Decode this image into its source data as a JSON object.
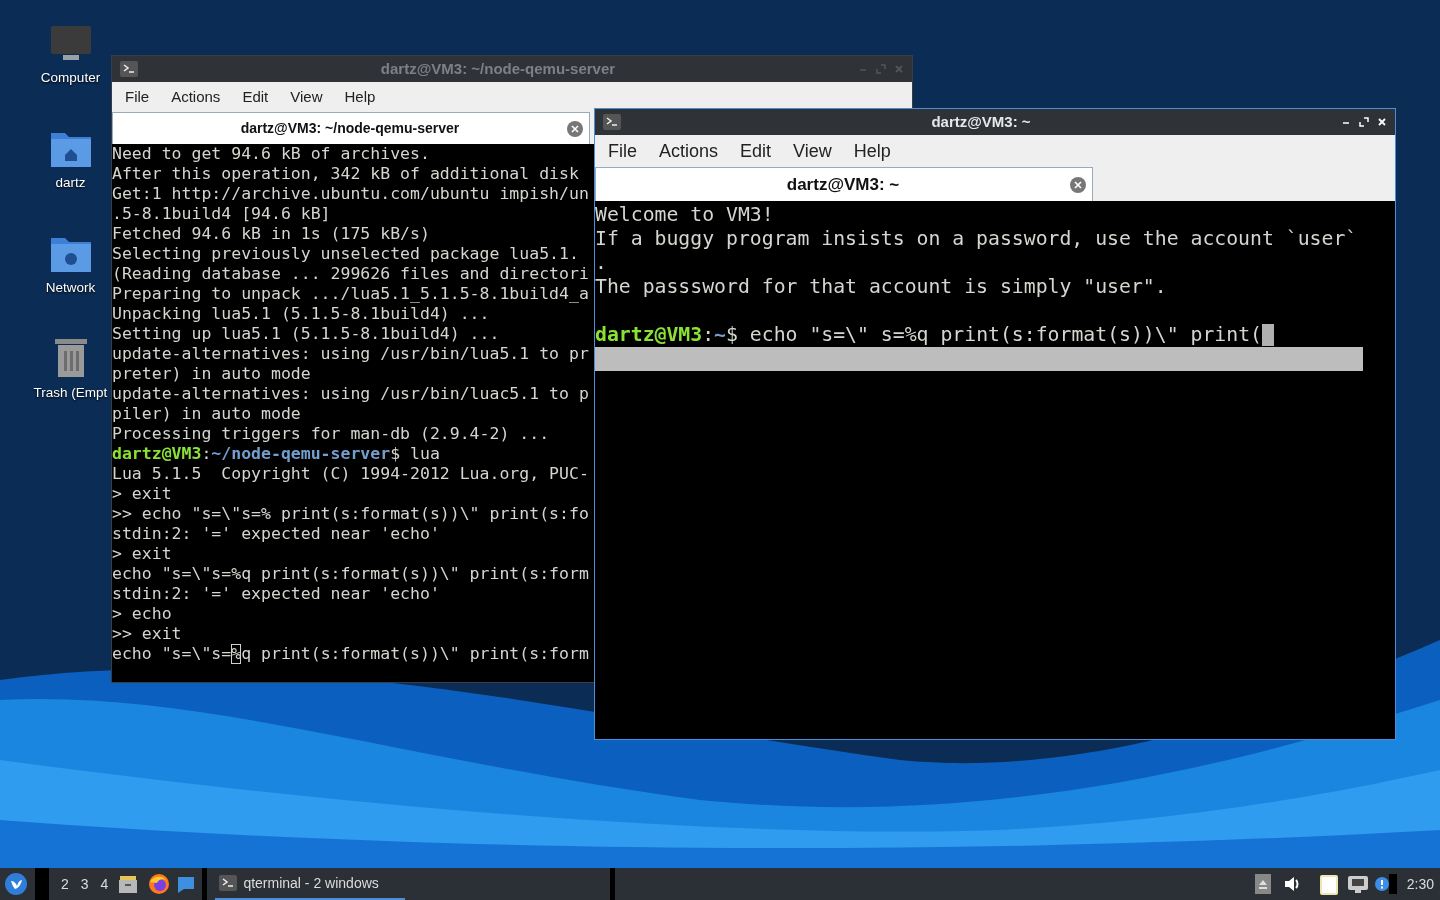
{
  "desktop_icons": [
    {
      "label": "Computer",
      "kind": "computer"
    },
    {
      "label": "dartz",
      "kind": "home"
    },
    {
      "label": "Network",
      "kind": "network"
    },
    {
      "label": "Trash (Empt",
      "kind": "trash"
    }
  ],
  "windows": [
    {
      "title": "dartz@VM3: ~/node-qemu-server",
      "active": false,
      "menu": [
        "File",
        "Actions",
        "Edit",
        "View",
        "Help"
      ],
      "tab": {
        "title": "dartz@VM3: ~/node-qemu-server"
      },
      "lines": [
        {
          "kind": "text",
          "text": "Need to get 94.6 kB of archives."
        },
        {
          "kind": "text",
          "text": "After this operation, 342 kB of additional disk"
        },
        {
          "kind": "text",
          "text": "Get:1 http://archive.ubuntu.com/ubuntu impish/un"
        },
        {
          "kind": "text",
          "text": ".5-8.1build4 [94.6 kB]"
        },
        {
          "kind": "text",
          "text": "Fetched 94.6 kB in 1s (175 kB/s)"
        },
        {
          "kind": "text",
          "text": "Selecting previously unselected package lua5.1."
        },
        {
          "kind": "text",
          "text": "(Reading database ... 299626 files and directori"
        },
        {
          "kind": "text",
          "text": "Preparing to unpack .../lua5.1_5.1.5-8.1build4_a"
        },
        {
          "kind": "text",
          "text": "Unpacking lua5.1 (5.1.5-8.1build4) ..."
        },
        {
          "kind": "text",
          "text": "Setting up lua5.1 (5.1.5-8.1build4) ..."
        },
        {
          "kind": "text",
          "text": "update-alternatives: using /usr/bin/lua5.1 to pr"
        },
        {
          "kind": "text",
          "text": "preter) in auto mode"
        },
        {
          "kind": "text",
          "text": "update-alternatives: using /usr/bin/luac5.1 to p"
        },
        {
          "kind": "text",
          "text": "piler) in auto mode"
        },
        {
          "kind": "text",
          "text": "Processing triggers for man-db (2.9.4-2) ..."
        },
        {
          "kind": "prompt",
          "user": "dartz@VM3",
          "sep": ":",
          "path": "~/node-qemu-server",
          "command": "$ lua",
          "cursor": false
        },
        {
          "kind": "text",
          "text": "Lua 5.1.5  Copyright (C) 1994-2012 Lua.org, PUC-"
        },
        {
          "kind": "text",
          "text": "> exit"
        },
        {
          "kind": "text",
          "text": ">> echo \"s=\\\"s=% print(s:format(s))\\\" print(s:fo"
        },
        {
          "kind": "text",
          "text": "stdin:2: '=' expected near 'echo'"
        },
        {
          "kind": "text",
          "text": "> exit"
        },
        {
          "kind": "text",
          "text": "echo \"s=\\\"s=%q print(s:format(s))\\\" print(s:form"
        },
        {
          "kind": "text",
          "text": "stdin:2: '=' expected near 'echo'"
        },
        {
          "kind": "text",
          "text": "> echo"
        },
        {
          "kind": "text",
          "text": ">> exit"
        },
        {
          "kind": "cursor_text",
          "before": "echo \"s=\\\"s=",
          "cursor": "%",
          "after": "q print(s:format(s))\\\" print(s:form"
        }
      ]
    },
    {
      "title": "dartz@VM3: ~",
      "active": true,
      "menu": [
        "File",
        "Actions",
        "Edit",
        "View",
        "Help"
      ],
      "tab": {
        "title": "dartz@VM3: ~"
      },
      "lines": [
        {
          "kind": "text",
          "text": "Welcome to VM3!"
        },
        {
          "kind": "text",
          "text": "If a buggy program insists on a password, use the account `user`"
        },
        {
          "kind": "text",
          "text": "."
        },
        {
          "kind": "text",
          "text": "The passsword for that account is simply \"user\"."
        },
        {
          "kind": "blank"
        },
        {
          "kind": "prompt",
          "user": "dartz@VM3",
          "sep": ":",
          "path": "~",
          "command": "$ echo \"s=\\\" s=%q print(s:format(s))\\\" print(",
          "cursor": true
        }
      ]
    }
  ],
  "taskbar": {
    "workspaces": [
      "2",
      "3",
      "4"
    ],
    "task": {
      "label": "qterminal - 2 windows",
      "selected": true
    },
    "clock": "2:30"
  }
}
